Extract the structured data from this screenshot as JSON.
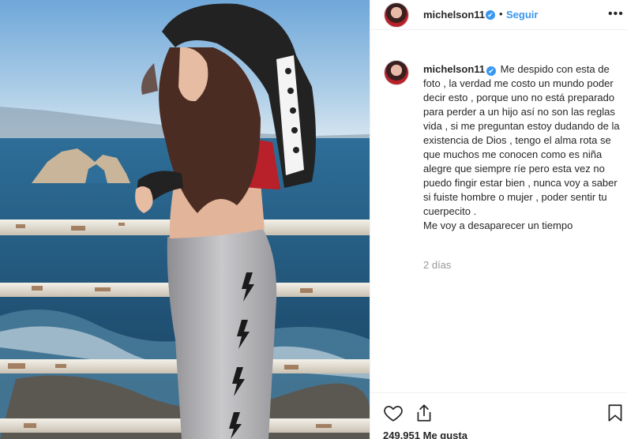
{
  "post": {
    "username": "michelson11",
    "verified_mark": "✔",
    "separator": "•",
    "follow_label": "Seguir",
    "more_label": "•••",
    "caption": "Me despido con esta de foto , la verdad me costo un mundo poder decir esto , porque uno no está preparado para perder a un hijo así no son las reglas vida , si me preguntan estoy dudando de la existencia de Dios , tengo el alma rota se que muchos me conocen como es niña alegre que siempre ríe pero esta vez no puedo fingir estar bien , nunca voy a saber si fuiste hombre o mujer , poder sentir tu cuerpecito .\nMe voy a desaparecer un tiempo",
    "time_ago": "2 días",
    "likes_count": "249.951",
    "likes_label": "Me gusta"
  },
  "icons": {
    "like": "heart-icon",
    "share": "share-icon",
    "save": "bookmark-icon",
    "verified": "verified-badge-icon",
    "more": "more-options-icon"
  },
  "colors": {
    "accent": "#3897f0",
    "text": "#262626",
    "muted": "#999999",
    "border": "#efefef"
  }
}
